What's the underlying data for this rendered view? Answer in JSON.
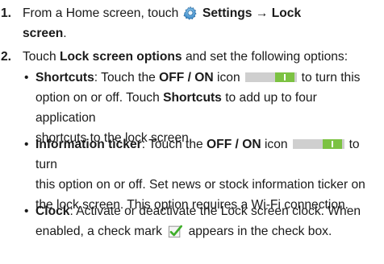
{
  "steps": [
    {
      "num": "1.",
      "line1_pre": "From a Home screen, touch",
      "settings": "Settings",
      "arrow": " → ",
      "lock_screen_a": "Lock",
      "lock_screen_b": "screen",
      "period": "."
    },
    {
      "num": "2.",
      "pre": "Touch ",
      "options_label": "Lock screen options",
      "post": " and set the following options:"
    }
  ],
  "bullets": {
    "shortcuts": {
      "label": "Shortcuts",
      "pre": ": Touch the ",
      "icon_label": "OFF / ON",
      "mid": " icon",
      "line1_end": "to turn this",
      "line2": "option on or off. Touch ",
      "line2_bold": "Shortcuts",
      "line2_end": " to add up to four application",
      "line3": "shortcuts to the lock screen."
    },
    "ticker": {
      "label": "Information ticker",
      "pre": ": Touch the ",
      "icon_label": "OFF / ON",
      "mid": " icon",
      "line1_end": "to turn",
      "line2": "this option on or off. Set news or stock information ticker on",
      "line3": "the lock screen. This option requires a Wi-Fi connection."
    },
    "clock": {
      "label": "Clock",
      "line1": ": Activate or deactivate the Lock screen clock. When",
      "line2_pre": "enabled, a check mark",
      "line2_post": "appears in the check box."
    }
  },
  "bullet_char": "•",
  "colors": {
    "toggle_on": "#7cc242",
    "toggle_track": "#cfcfcf",
    "check_green": "#3fae2a"
  },
  "icons": {
    "settings": "gear-icon",
    "toggle": "toggle-switch-icon",
    "check": "check-mark-icon"
  }
}
